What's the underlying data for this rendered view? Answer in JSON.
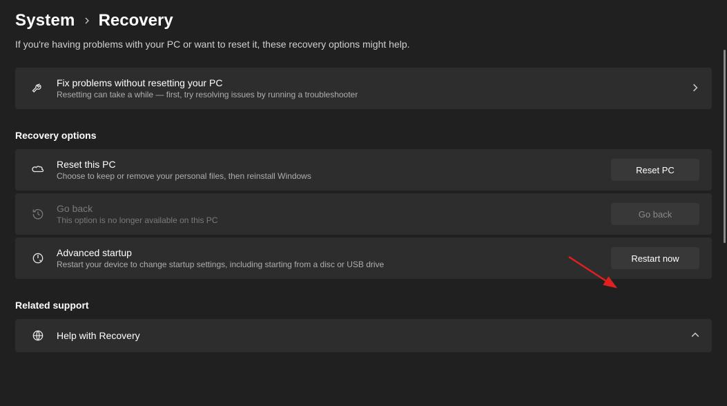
{
  "breadcrumb": {
    "parent": "System",
    "current": "Recovery"
  },
  "intro": "If you're having problems with your PC or want to reset it, these recovery options might help.",
  "fix": {
    "title": "Fix problems without resetting your PC",
    "desc": "Resetting can take a while — first, try resolving issues by running a troubleshooter"
  },
  "sections": {
    "recovery_options": "Recovery options",
    "related_support": "Related support"
  },
  "reset": {
    "title": "Reset this PC",
    "desc": "Choose to keep or remove your personal files, then reinstall Windows",
    "button": "Reset PC"
  },
  "goback": {
    "title": "Go back",
    "desc": "This option is no longer available on this PC",
    "button": "Go back"
  },
  "advanced": {
    "title": "Advanced startup",
    "desc": "Restart your device to change startup settings, including starting from a disc or USB drive",
    "button": "Restart now"
  },
  "help": {
    "title": "Help with Recovery"
  }
}
